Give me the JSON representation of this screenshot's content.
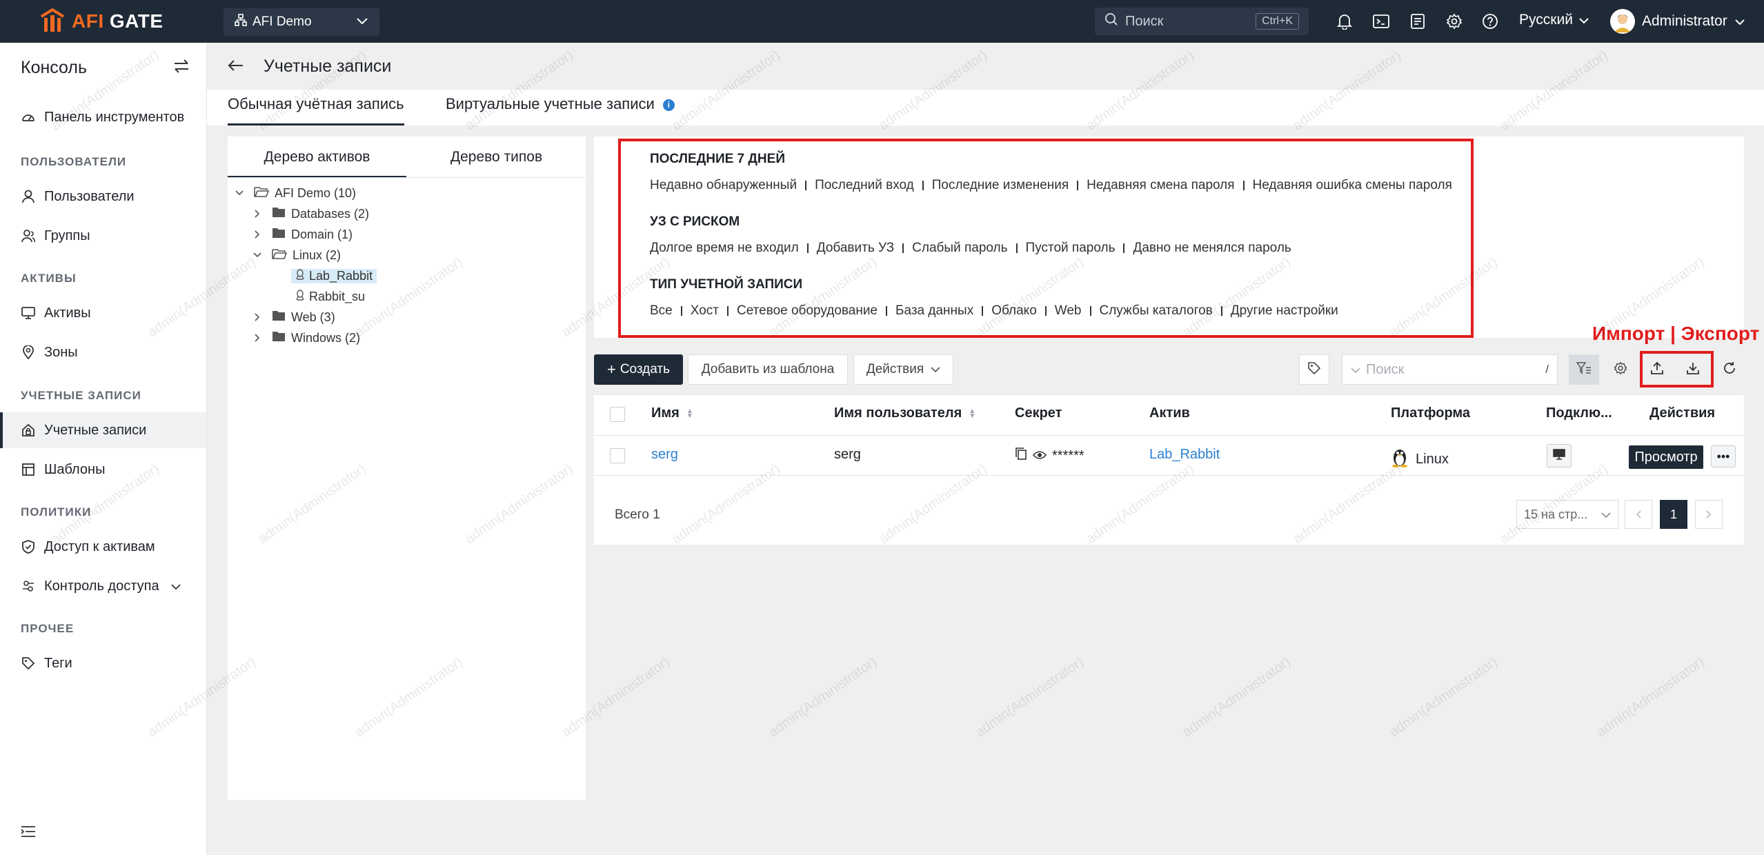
{
  "brand": {
    "logo_text_a": "AFI",
    "logo_text_b": " GATE",
    "accent": "#f26a22",
    "dark": "#1f2a37"
  },
  "topbar": {
    "org": "AFI Demo",
    "search_placeholder": "Поиск",
    "search_shortcut": "Ctrl+K",
    "language": "Русский",
    "user": "Administrator",
    "icons": [
      "bell-icon",
      "terminal-icon",
      "clipboard-icon",
      "gear-icon",
      "help-icon"
    ]
  },
  "sidebar": {
    "title": "Консоль",
    "sections": {
      "users": "ПОЛЬЗОВАТЕЛИ",
      "assets": "АКТИВЫ",
      "accounts": "УЧЕТНЫЕ ЗАПИСИ",
      "policies": "ПОЛИТИКИ",
      "other": "ПРОЧЕЕ"
    },
    "items": {
      "dashboard": "Панель инструментов",
      "users": "Пользователи",
      "groups": "Группы",
      "assets": "Активы",
      "zones": "Зоны",
      "accounts": "Учетные записи",
      "templates": "Шаблоны",
      "asset_access": "Доступ к активам",
      "access_control": "Контроль доступа",
      "tags": "Теги"
    }
  },
  "page": {
    "title": "Учетные записи",
    "tabs": {
      "regular": "Обычная учётная запись",
      "virtual": "Виртуальные учетные записи"
    }
  },
  "tree": {
    "tabs": {
      "assets": "Дерево активов",
      "types": "Дерево типов"
    },
    "nodes": {
      "root": "AFI Demo (10)",
      "databases": "Databases (2)",
      "domain": "Domain (1)",
      "linux": "Linux (2)",
      "lab_rabbit": "Lab_Rabbit",
      "rabbit_su": "Rabbit_su",
      "web": "Web (3)",
      "windows": "Windows (2)"
    }
  },
  "filters": {
    "recent": {
      "title": "ПОСЛЕДНИЕ 7 ДНЕЙ",
      "items": [
        "Недавно обнаруженный",
        "Последний вход",
        "Последние изменения",
        "Недавняя смена пароля",
        "Недавняя ошибка смены пароля"
      ]
    },
    "risk": {
      "title": "УЗ С РИСКОМ",
      "items": [
        "Долгое время не входил",
        "Добавить УЗ",
        "Слабый пароль",
        "Пустой пароль",
        "Давно не менялся пароль"
      ]
    },
    "type": {
      "title": "ТИП УЧЕТНОЙ ЗАПИСИ",
      "items": [
        "Все",
        "Хост",
        "Сетевое оборудование",
        "База данных",
        "Облако",
        "Web",
        "Службы каталогов",
        "Другие настройки"
      ]
    }
  },
  "toolbar": {
    "create": "Создать",
    "from_template": "Добавить из шаблона",
    "actions": "Действия",
    "search_placeholder": "Поиск",
    "search_slash": "/",
    "import_export_label": "Импорт | Экспорт"
  },
  "table": {
    "headers": {
      "name": "Имя",
      "username": "Имя пользователя",
      "secret": "Секрет",
      "asset": "Актив",
      "platform": "Платформа",
      "connect": "Подклю...",
      "actions": "Действия"
    },
    "rows": [
      {
        "name": "serg",
        "username": "serg",
        "secret": "******",
        "asset": "Lab_Rabbit",
        "platform": "Linux",
        "view": "Просмотр",
        "more": "•••"
      }
    ],
    "total": "Всего 1",
    "page_size": "15 на стр...",
    "current_page": "1"
  },
  "watermark": "admin(Administrator)"
}
